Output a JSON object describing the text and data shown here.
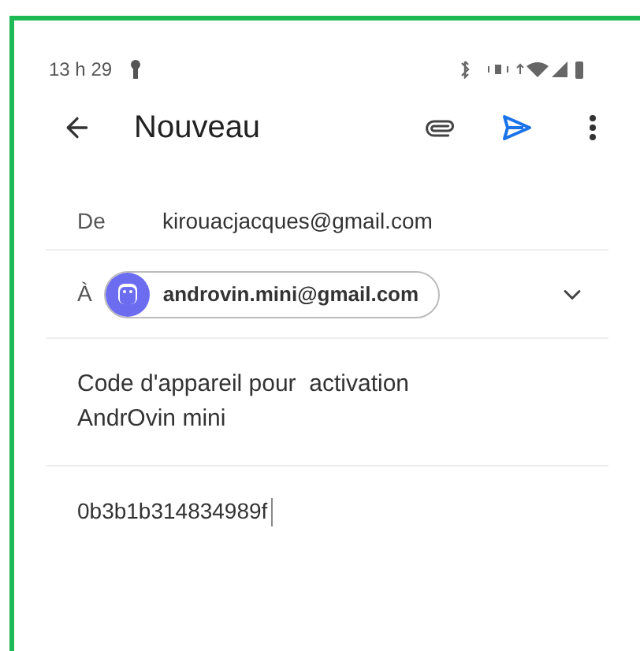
{
  "status_bar": {
    "time": "13 h 29"
  },
  "toolbar": {
    "title": "Nouveau"
  },
  "from": {
    "label": "De",
    "value": "kirouacjacques@gmail.com"
  },
  "to": {
    "label": "À",
    "recipients": [
      "androvin.mini@gmail.com"
    ]
  },
  "subject": {
    "value": "Code d'appareil pour  activation AndrOvin mini"
  },
  "body": {
    "value": "0b3b1b314834989f"
  }
}
